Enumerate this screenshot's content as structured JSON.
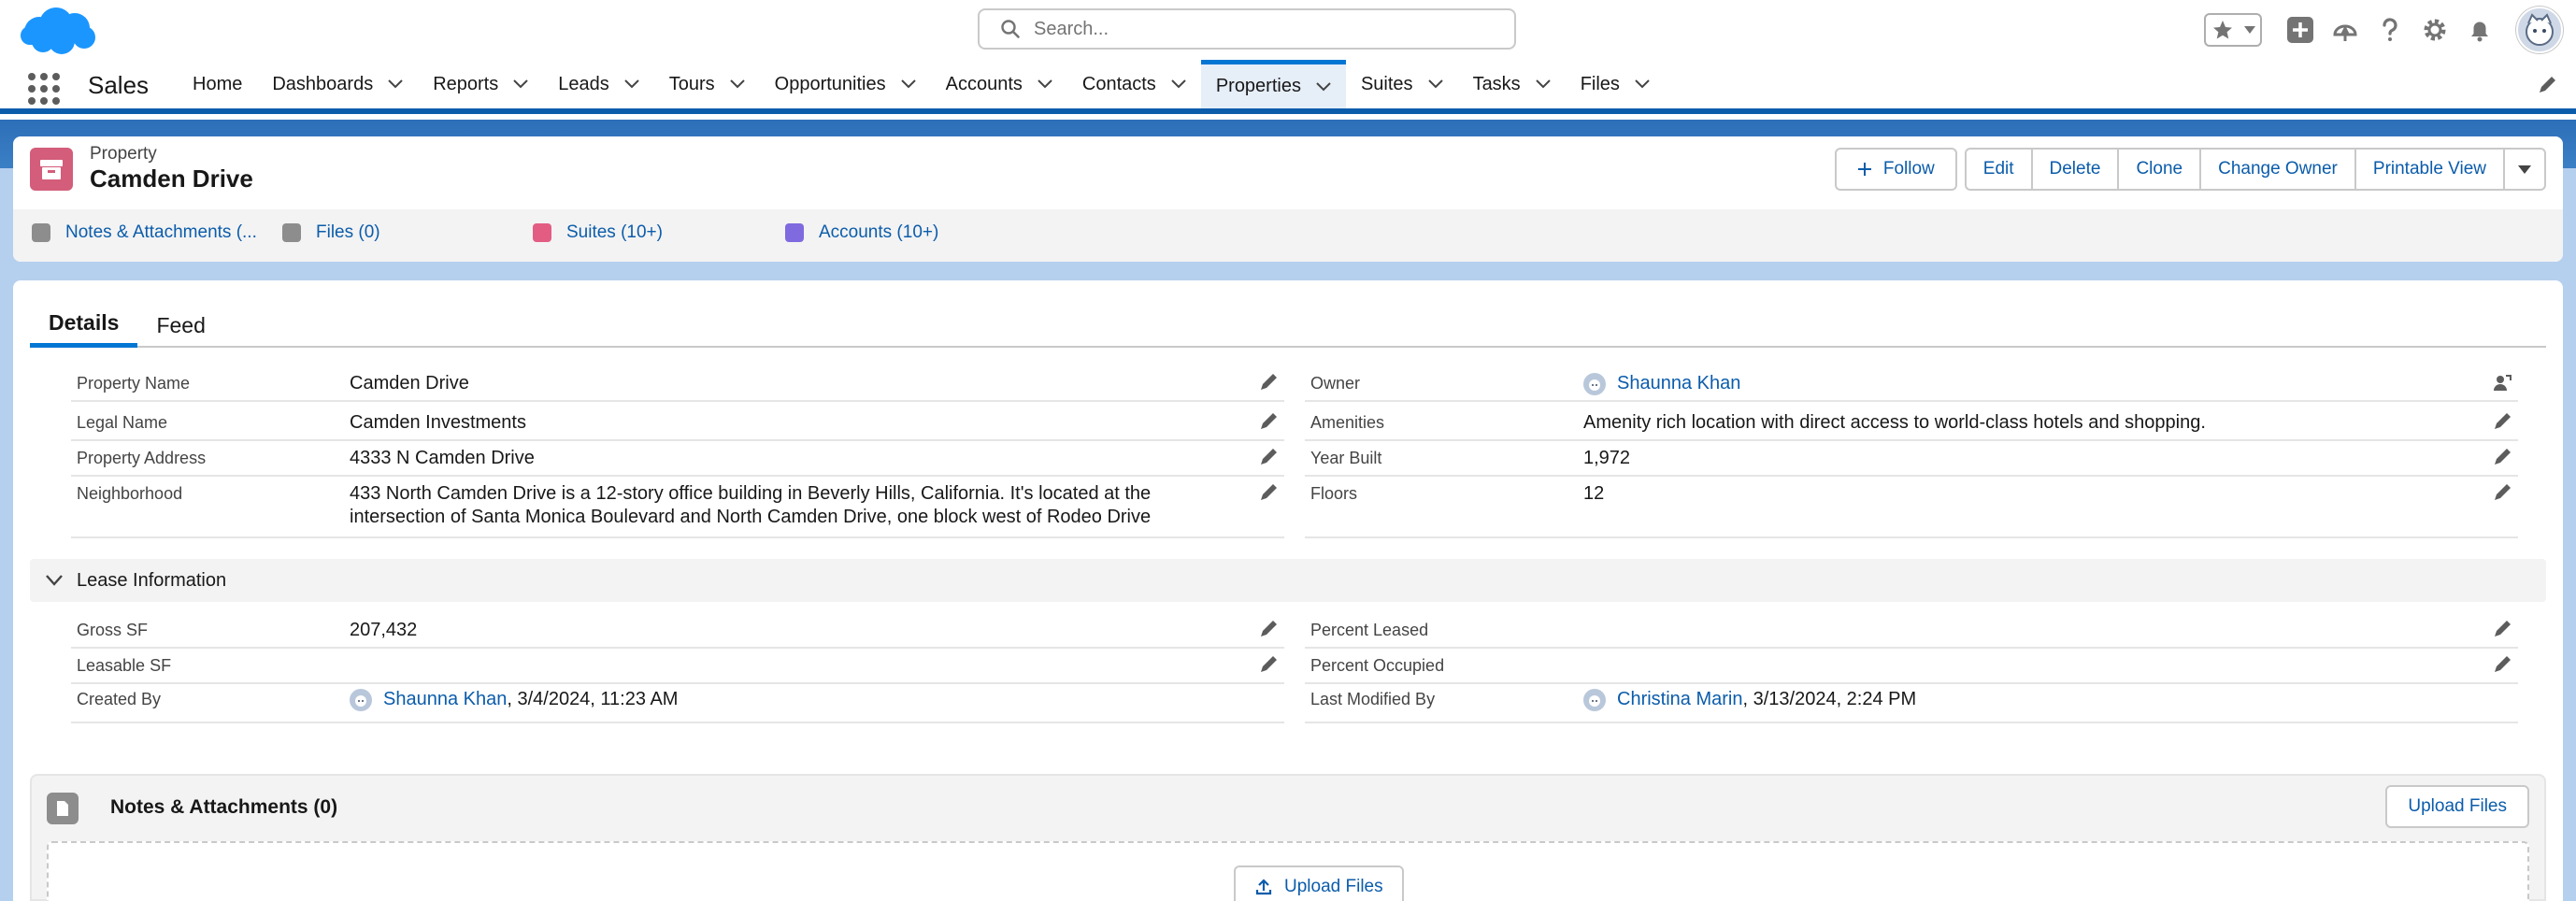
{
  "colors": {
    "brand": "#0176d3",
    "link": "#0b5cab",
    "record_icon": "#d35d7a",
    "suites_icon": "#e35d83",
    "accounts_icon": "#7f6adf"
  },
  "header": {
    "search_placeholder": "Search...",
    "icons": [
      "salesforce-cloud-logo",
      "favorites-star-icon",
      "global-actions-plus-icon",
      "trailhead-icon",
      "help-icon",
      "setup-gear-icon",
      "notifications-bell-icon",
      "user-avatar"
    ]
  },
  "nav": {
    "app_name": "Sales",
    "items": [
      {
        "label": "Home",
        "menu": false
      },
      {
        "label": "Dashboards",
        "menu": true
      },
      {
        "label": "Reports",
        "menu": true
      },
      {
        "label": "Leads",
        "menu": true
      },
      {
        "label": "Tours",
        "menu": true
      },
      {
        "label": "Opportunities",
        "menu": true
      },
      {
        "label": "Accounts",
        "menu": true
      },
      {
        "label": "Contacts",
        "menu": true
      },
      {
        "label": "Properties",
        "menu": true,
        "active": true
      },
      {
        "label": "Suites",
        "menu": true
      },
      {
        "label": "Tasks",
        "menu": true
      },
      {
        "label": "Files",
        "menu": true
      }
    ]
  },
  "record": {
    "type": "Property",
    "title": "Camden Drive",
    "actions": {
      "follow": "Follow",
      "edit": "Edit",
      "delete": "Delete",
      "clone": "Clone",
      "change_owner": "Change Owner",
      "printable_view": "Printable View"
    },
    "related_links": [
      {
        "label": "Notes & Attachments (..."
      },
      {
        "label": "Files (0)"
      },
      {
        "label": "Suites (10+)"
      },
      {
        "label": "Accounts (10+)"
      }
    ]
  },
  "tabs": {
    "details": "Details",
    "feed": "Feed"
  },
  "fields": {
    "property_name": {
      "label": "Property Name",
      "value": "Camden Drive"
    },
    "legal_name": {
      "label": "Legal Name",
      "value": "Camden Investments"
    },
    "property_address": {
      "label": "Property Address",
      "value": "4333 N Camden Drive"
    },
    "neighborhood": {
      "label": "Neighborhood",
      "value_line1": "433 North Camden Drive is a 12-story office building in Beverly Hills, California. It's located at the",
      "value_line2": "intersection of Santa Monica Boulevard and North Camden Drive, one block west of Rodeo Drive"
    },
    "owner": {
      "label": "Owner",
      "value": "Shaunna Khan"
    },
    "amenities": {
      "label": "Amenities",
      "value": "Amenity rich location with direct access to world-class hotels and shopping."
    },
    "year_built": {
      "label": "Year Built",
      "value": "1,972"
    },
    "floors": {
      "label": "Floors",
      "value": "12"
    }
  },
  "lease_section": {
    "title": "Lease Information",
    "gross_sf": {
      "label": "Gross SF",
      "value": "207,432"
    },
    "leasable_sf": {
      "label": "Leasable SF",
      "value": ""
    },
    "created_by": {
      "label": "Created By",
      "user": "Shaunna Khan",
      "date": ", 3/4/2024, 11:23 AM"
    },
    "percent_leased": {
      "label": "Percent Leased",
      "value": ""
    },
    "percent_occupied": {
      "label": "Percent Occupied",
      "value": ""
    },
    "last_modified_by": {
      "label": "Last Modified By",
      "user": "Christina Marin",
      "date": ", 3/13/2024, 2:24 PM"
    }
  },
  "notes_card": {
    "title": "Notes & Attachments (0)",
    "upload_button": "Upload Files",
    "dropzone_button": "Upload Files"
  }
}
